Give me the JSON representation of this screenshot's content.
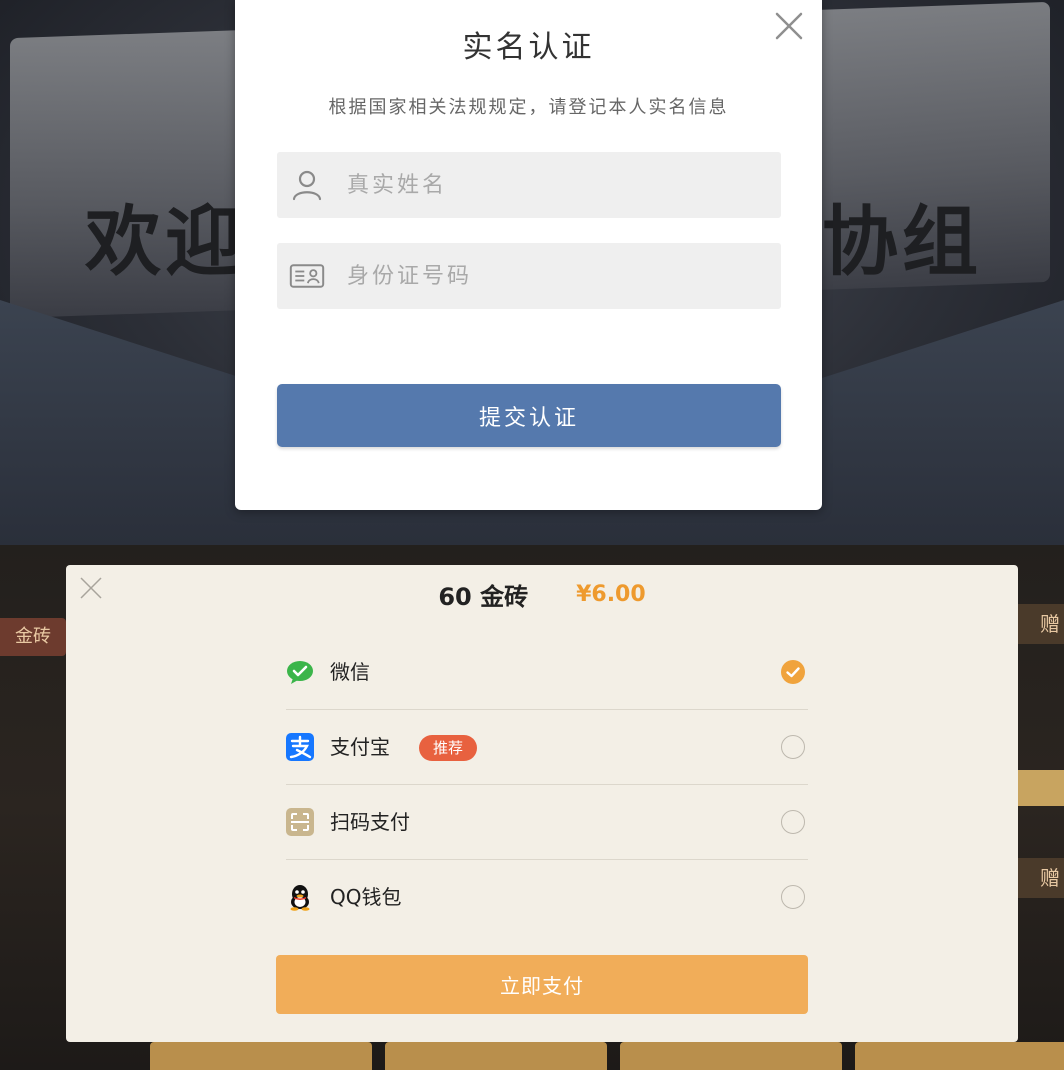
{
  "background": {
    "title_left": "欢迎",
    "title_right": "协组",
    "tag_left": "金砖",
    "tag_right": "赠"
  },
  "verify_dialog": {
    "title": "实名认证",
    "subtitle": "根据国家相关法规规定，请登记本人实名信息",
    "name_field": {
      "placeholder": "真实姓名",
      "value": ""
    },
    "id_field": {
      "placeholder": "身份证号码",
      "value": ""
    },
    "submit_label": "提交认证"
  },
  "payment": {
    "product": "60 金砖",
    "price": "¥6.00",
    "methods": [
      {
        "label": "微信",
        "icon": "wechat-icon",
        "selected": true
      },
      {
        "label": "支付宝",
        "icon": "alipay-icon",
        "badge": "推荐",
        "selected": false
      },
      {
        "label": "扫码支付",
        "icon": "qr-scan-icon",
        "selected": false
      },
      {
        "label": "QQ钱包",
        "icon": "qq-icon",
        "selected": false
      }
    ],
    "pay_label": "立即支付"
  },
  "colors": {
    "verify_button": "#5579ad",
    "pay_button": "#f1ad59",
    "price": "#ee9a2e",
    "radio_checked": "#f0a33c",
    "badge": "#e8613f",
    "wechat": "#3bb54a",
    "alipay": "#1677ff"
  }
}
